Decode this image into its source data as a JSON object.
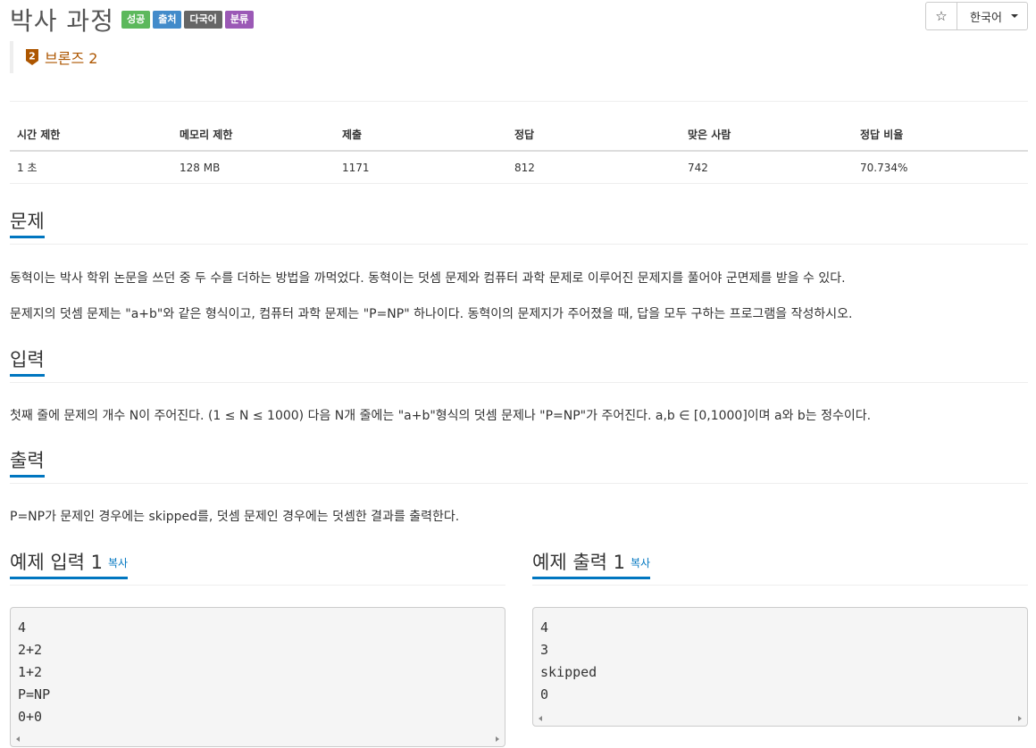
{
  "problem": {
    "title": "박사 과정",
    "labels": [
      "성공",
      "출처",
      "다국어",
      "분류"
    ],
    "tier_icon": "tier-bronze-badge-icon",
    "tier_number": "2",
    "tier": "브론즈 2"
  },
  "toolbar": {
    "star": "☆",
    "language": "한국어"
  },
  "info_table": {
    "headers": [
      "시간 제한",
      "메모리 제한",
      "제출",
      "정답",
      "맞은 사람",
      "정답 비율"
    ],
    "values": [
      "1 초",
      "128 MB",
      "1171",
      "812",
      "742",
      "70.734%"
    ]
  },
  "sections": {
    "problem_title": "문제",
    "problem_text_1": "동혁이는 박사 학위 논문을 쓰던 중 두 수를 더하는 방법을 까먹었다. 동혁이는 덧셈 문제와 컴퓨터 과학 문제로 이루어진 문제지를 풀어야 군면제를 받을 수 있다.",
    "problem_text_2": "문제지의 덧셈 문제는 \"a+b\"와 같은 형식이고, 컴퓨터 과학 문제는 \"P=NP\" 하나이다. 동혁이의 문제지가 주어졌을 때, 답을 모두 구하는 프로그램을 작성하시오.",
    "input_title": "입력",
    "input_text": "첫째 줄에 문제의 개수 N이 주어진다. (1 ≤ N ≤ 1000) 다음 N개 줄에는 \"a+b\"형식의 덧셈 문제나 \"P=NP\"가 주어진다. a,b ∈ [0,1000]이며 a와 b는 정수이다.",
    "output_title": "출력",
    "output_text": "P=NP가 문제인 경우에는 skipped를, 덧셈 문제인 경우에는 덧셈한 결과를 출력한다."
  },
  "samples": {
    "input_title": "예제 입력 1",
    "output_title": "예제 출력 1",
    "copy_label": "복사",
    "input_lines": [
      "4",
      "2+2",
      "1+2",
      "P=NP",
      "0+0"
    ],
    "output_lines": [
      "4",
      "3",
      "skipped",
      "0"
    ]
  },
  "colors": {
    "tier": "#ad5600",
    "accent": "#0076c0",
    "label_success": "#5cb85c",
    "label_source": "#428bca",
    "label_multilang": "#666666",
    "label_class": "#9b59b6"
  }
}
